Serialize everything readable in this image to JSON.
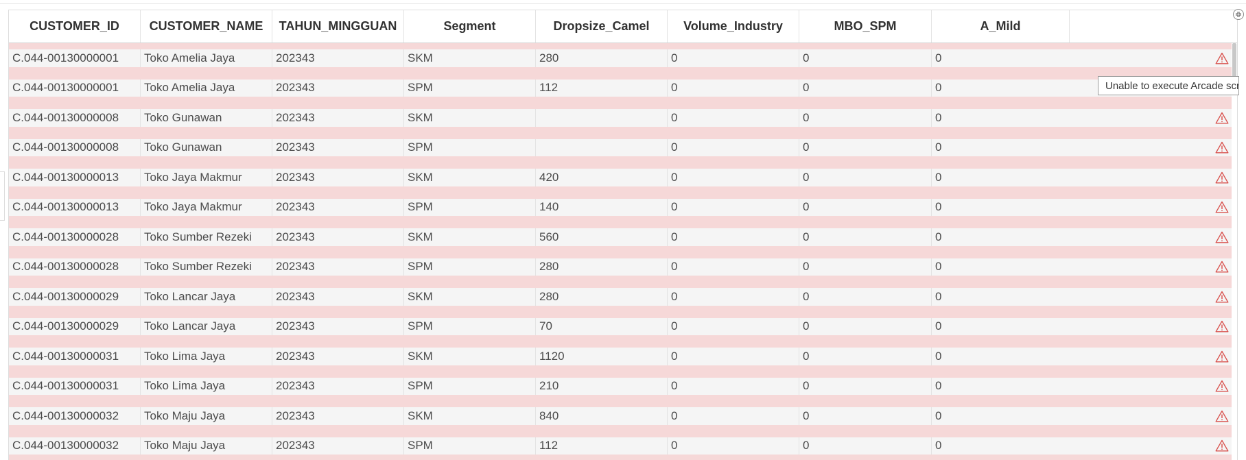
{
  "table": {
    "columns": [
      "CUSTOMER_ID",
      "CUSTOMER_NAME",
      "TAHUN_MINGGUAN",
      "Segment",
      "Dropsize_Camel",
      "Volume_Industry",
      "MBO_SPM",
      "A_Mild"
    ],
    "rows": [
      [
        "C.044-00130000001",
        "Toko Amelia Jaya",
        "202343",
        "SKM",
        "280",
        "0",
        "0",
        "0"
      ],
      [
        "C.044-00130000001",
        "Toko Amelia Jaya",
        "202343",
        "SPM",
        "112",
        "0",
        "0",
        "0"
      ],
      [
        "C.044-00130000008",
        "Toko Gunawan",
        "202343",
        "SKM",
        "",
        "0",
        "0",
        "0"
      ],
      [
        "C.044-00130000008",
        "Toko Gunawan",
        "202343",
        "SPM",
        "",
        "0",
        "0",
        "0"
      ],
      [
        "C.044-00130000013",
        "Toko Jaya Makmur",
        "202343",
        "SKM",
        "420",
        "0",
        "0",
        "0"
      ],
      [
        "C.044-00130000013",
        "Toko Jaya Makmur",
        "202343",
        "SPM",
        "140",
        "0",
        "0",
        "0"
      ],
      [
        "C.044-00130000028",
        "Toko Sumber Rezeki",
        "202343",
        "SKM",
        "560",
        "0",
        "0",
        "0"
      ],
      [
        "C.044-00130000028",
        "Toko Sumber Rezeki",
        "202343",
        "SPM",
        "280",
        "0",
        "0",
        "0"
      ],
      [
        "C.044-00130000029",
        "Toko Lancar Jaya",
        "202343",
        "SKM",
        "280",
        "0",
        "0",
        "0"
      ],
      [
        "C.044-00130000029",
        "Toko Lancar Jaya",
        "202343",
        "SPM",
        "70",
        "0",
        "0",
        "0"
      ],
      [
        "C.044-00130000031",
        "Toko Lima Jaya",
        "202343",
        "SKM",
        "1120",
        "0",
        "0",
        "0"
      ],
      [
        "C.044-00130000031",
        "Toko Lima Jaya",
        "202343",
        "SPM",
        "210",
        "0",
        "0",
        "0"
      ],
      [
        "C.044-00130000032",
        "Toko Maju Jaya",
        "202343",
        "SKM",
        "840",
        "0",
        "0",
        "0"
      ],
      [
        "C.044-00130000032",
        "Toko Maju Jaya",
        "202343",
        "SPM",
        "112",
        "0",
        "0",
        "0"
      ]
    ],
    "warning_rows": [
      0,
      2,
      3,
      4,
      5,
      6,
      7,
      8,
      9,
      10,
      11,
      12,
      13
    ]
  },
  "tooltip": {
    "text": "Unable to execute Arcade script"
  },
  "icons": {
    "warning": "warning-triangle-icon",
    "collapse": "collapse-icon"
  },
  "colors": {
    "row_band": "#f6d8d8",
    "row_body": "#f5f5f5",
    "warning": "#d9534f"
  }
}
